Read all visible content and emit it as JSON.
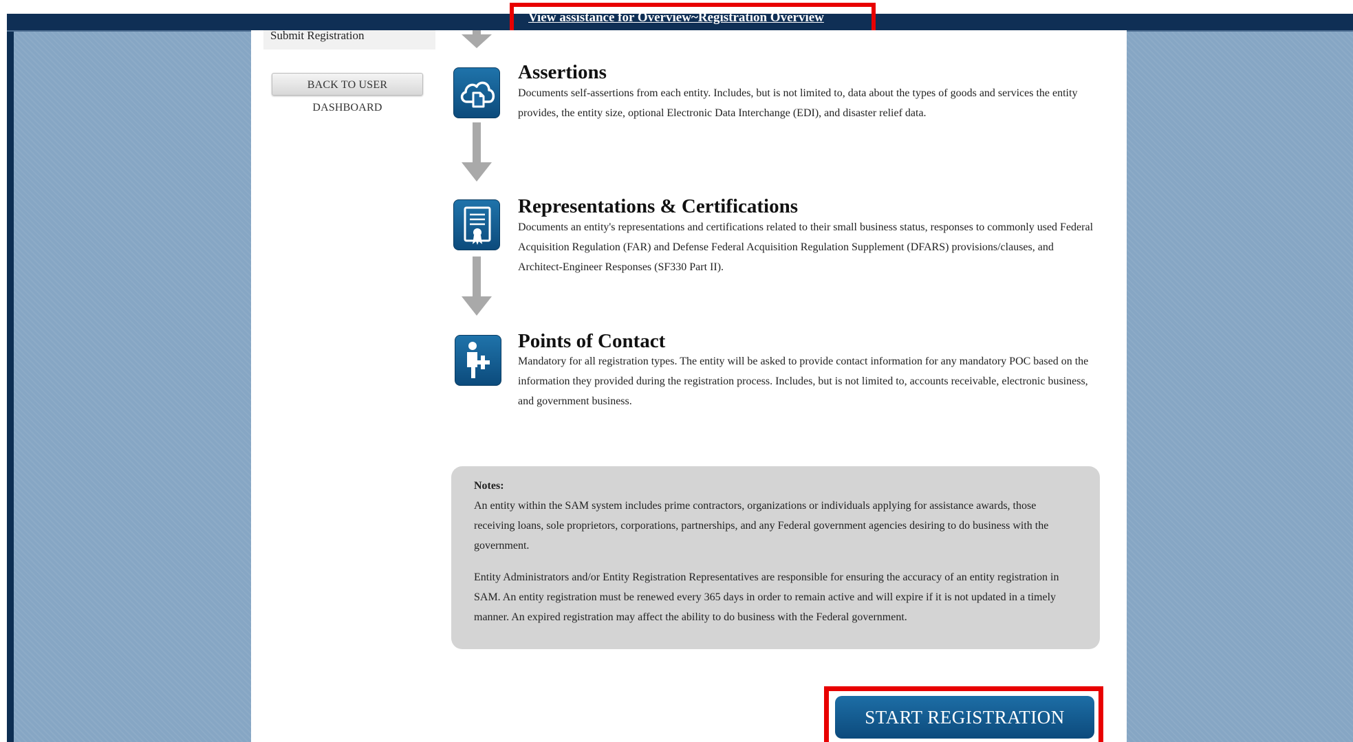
{
  "header": {
    "assistance_link": "View assistance for Overview~Registration Overview"
  },
  "sidebar": {
    "current_item": "Submit Registration",
    "back_button": "BACK TO USER DASHBOARD"
  },
  "steps": [
    {
      "title": "Assertions",
      "icon": "cloud-document-icon",
      "description": "Documents self-assertions from each entity. Includes, but is not limited to, data about the types of goods and services the entity provides, the entity size, optional Electronic Data Interchange (EDI), and disaster relief data."
    },
    {
      "title": "Representations & Certifications",
      "icon": "certificate-icon",
      "description": "Documents an entity's representations and certifications related to their small business status, responses to commonly used Federal Acquisition Regulation (FAR) and Defense Federal Acquisition Regulation Supplement (DFARS) provisions/clauses, and Architect-Engineer Responses (SF330 Part II)."
    },
    {
      "title": "Points of Contact",
      "icon": "person-add-icon",
      "description": "Mandatory for all registration types. The entity will be asked to provide contact information for any mandatory POC based on the information they provided during the registration process. Includes, but is not limited to, accounts receivable, electronic business, and government business."
    }
  ],
  "notes": {
    "title": "Notes:",
    "paragraphs": [
      "An entity within the SAM system includes prime contractors, organizations or individuals applying for assistance awards, those receiving loans, sole proprietors, corporations, partnerships, and any Federal government agencies desiring to do business with the government.",
      "Entity Administrators and/or Entity Registration Representatives are responsible for ensuring the accuracy of an entity registration in SAM. An entity registration must be renewed every 365 days in order to remain active and will expire if it is not updated in a timely manner. An expired registration may affect the ability to do business with the Federal government."
    ]
  },
  "actions": {
    "start_button": "START REGISTRATION"
  },
  "colors": {
    "header_navy": "#0f2f55",
    "background_blue": "#86a6c4",
    "icon_blue": "#0c4b7c",
    "highlight_red": "#e80000",
    "notes_gray": "#d4d4d4"
  }
}
